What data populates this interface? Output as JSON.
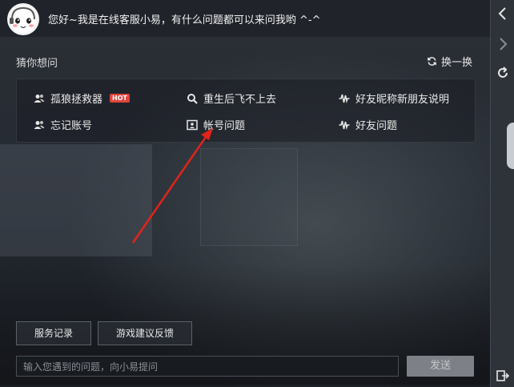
{
  "header": {
    "greeting": "您好~我是在线客服小易，有什么问题都可以来问我哟 ^-^"
  },
  "suggestions": {
    "title": "猜你想问",
    "refresh_label": "换一换",
    "items": [
      {
        "label": "孤狼拯救器",
        "icon": "users-icon",
        "badge": "HOT"
      },
      {
        "label": "重生后飞不上去",
        "icon": "search-icon"
      },
      {
        "label": "好友昵称新朋友说明",
        "icon": "waveform-icon"
      },
      {
        "label": "忘记账号",
        "icon": "users-icon"
      },
      {
        "label": "帐号问题",
        "icon": "id-card-icon"
      },
      {
        "label": "好友问题",
        "icon": "waveform-icon"
      }
    ]
  },
  "footer": {
    "service_record_label": "服务记录",
    "feedback_label": "游戏建议反馈",
    "input_placeholder": "输入您遇到的问题，向小易提问",
    "send_label": "发送"
  },
  "colors": {
    "arrow": "#e2231a",
    "hot_badge": "#e0443b",
    "send_button": "#7d8187"
  }
}
